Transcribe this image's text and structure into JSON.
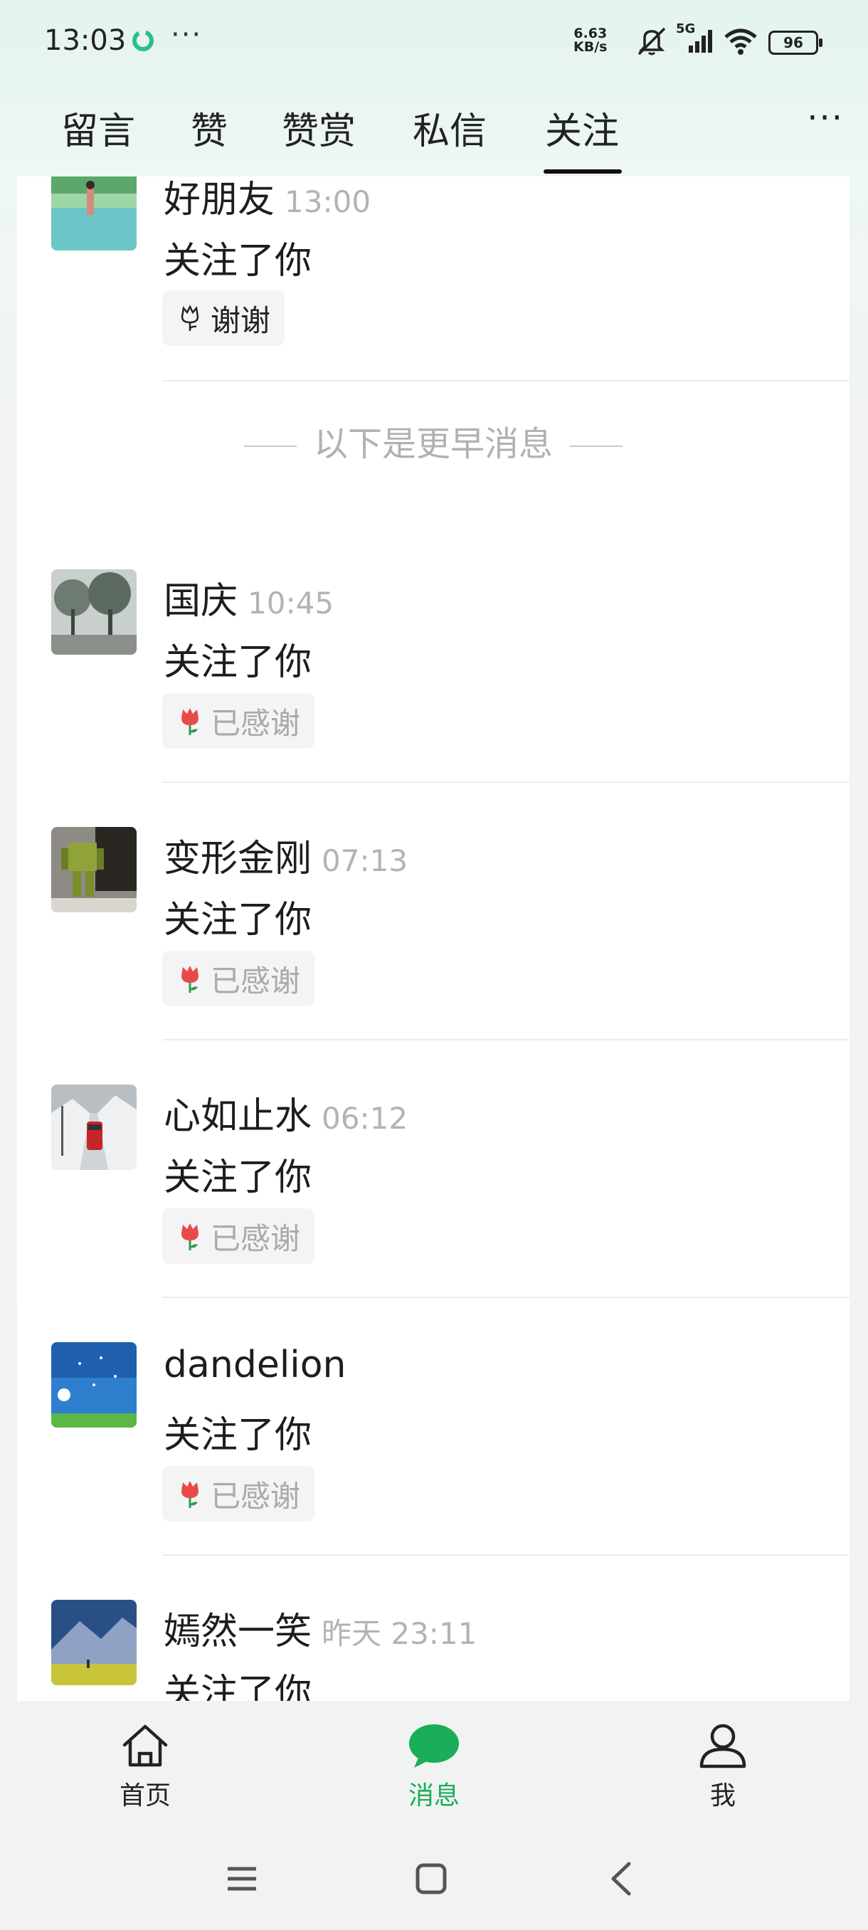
{
  "status_bar": {
    "time": "13:03",
    "net_speed_value": "6.63",
    "net_speed_unit": "KB/s",
    "network_type": "5G",
    "battery": "96"
  },
  "tabs": {
    "items": [
      {
        "label": "留言",
        "active": false
      },
      {
        "label": "赞",
        "active": false
      },
      {
        "label": "赞赏",
        "active": false
      },
      {
        "label": "私信",
        "active": false
      },
      {
        "label": "关注",
        "active": true
      }
    ],
    "more_icon": "more-horizontal-icon"
  },
  "divider_label": "以下是更早消息",
  "notifications": [
    {
      "name": "好朋友",
      "time": "13:00",
      "action": "关注了你",
      "thank_label": "谢谢",
      "thanked": false,
      "avatar": "lake-scene"
    },
    {
      "name": "国庆",
      "time": "10:45",
      "action": "关注了你",
      "thank_label": "已感谢",
      "thanked": true,
      "avatar": "foggy-trees"
    },
    {
      "name": "变形金刚",
      "time": "07:13",
      "action": "关注了你",
      "thank_label": "已感谢",
      "thanked": true,
      "avatar": "robot-toy"
    },
    {
      "name": "心如止水",
      "time": "06:12",
      "action": "关注了你",
      "thank_label": "已感谢",
      "thanked": true,
      "avatar": "snow-train"
    },
    {
      "name": "dandelion",
      "time": "",
      "action": "关注了你",
      "thank_label": "已感谢",
      "thanked": true,
      "avatar": "dandelion-sky"
    },
    {
      "name": "嫣然一笑",
      "time": "昨天 23:11",
      "action": "关注了你",
      "thank_label": "",
      "thanked": true,
      "avatar": "mountain-field"
    }
  ],
  "bottom_nav": [
    {
      "label": "首页",
      "icon": "home-icon",
      "active": false
    },
    {
      "label": "消息",
      "icon": "message-bubble-icon",
      "active": true
    },
    {
      "label": "我",
      "icon": "person-icon",
      "active": false
    }
  ],
  "system_nav": [
    "menu-icon",
    "home-square-icon",
    "back-icon"
  ],
  "colors": {
    "accent": "#1aad5a",
    "flower": "#e84a4a"
  }
}
